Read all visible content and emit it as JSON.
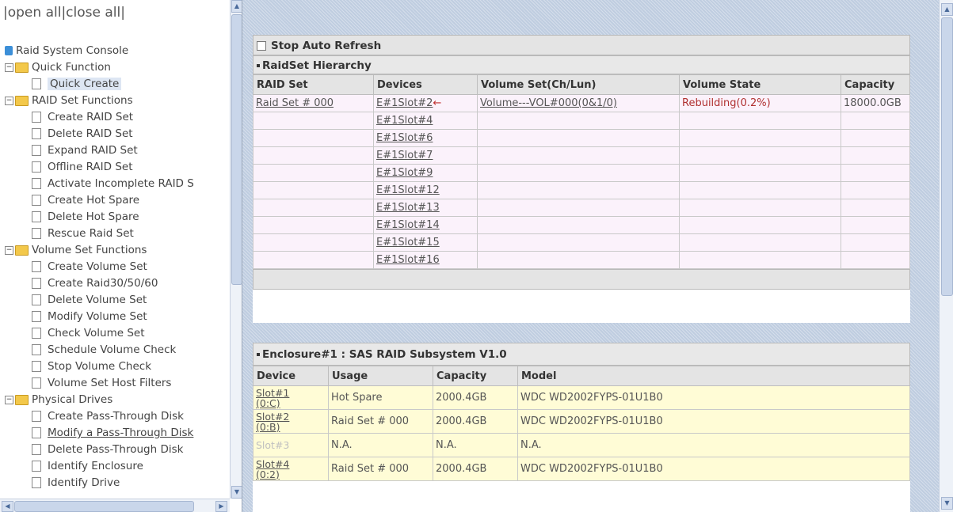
{
  "left": {
    "open_all": "open all",
    "close_all": "close all",
    "root": "Raid System Console",
    "groups": [
      {
        "label": "Quick Function",
        "items": [
          "Quick Create"
        ]
      },
      {
        "label": "RAID Set Functions",
        "items": [
          "Create RAID Set",
          "Delete RAID Set",
          "Expand RAID Set",
          "Offline RAID Set",
          "Activate Incomplete RAID S",
          "Create Hot Spare",
          "Delete Hot Spare",
          "Rescue Raid Set"
        ]
      },
      {
        "label": "Volume Set Functions",
        "items": [
          "Create Volume Set",
          "Create Raid30/50/60",
          "Delete Volume Set",
          "Modify Volume Set",
          "Check Volume Set",
          "Schedule Volume Check",
          "Stop Volume Check",
          "Volume Set Host Filters"
        ]
      },
      {
        "label": "Physical Drives",
        "items": [
          "Create Pass-Through Disk",
          "Modify a Pass-Through Disk",
          "Delete Pass-Through Disk",
          "Identify Enclosure",
          "Identify Drive"
        ]
      }
    ]
  },
  "refresh": {
    "label": "Stop Auto Refresh"
  },
  "raidset": {
    "title": "RaidSet Hierarchy",
    "headers": [
      "RAID Set",
      "Devices",
      "Volume Set(Ch/Lun)",
      "Volume State",
      "Capacity"
    ],
    "raid_set": "Raid Set # 000",
    "volume": "Volume---VOL#000(0&1/0)",
    "state": "Rebuilding(0.2%)",
    "capacity": "18000.0GB",
    "rebuild_arrow": "←",
    "devices": [
      "E#1Slot#2",
      "E#1Slot#4",
      "E#1Slot#6",
      "E#1Slot#7",
      "E#1Slot#9",
      "E#1Slot#12",
      "E#1Slot#13",
      "E#1Slot#14",
      "E#1Slot#15",
      "E#1Slot#16"
    ]
  },
  "enclosure": {
    "title": "Enclosure#1 : SAS RAID Subsystem V1.0",
    "headers": [
      "Device",
      "Usage",
      "Capacity",
      "Model"
    ],
    "rows": [
      {
        "device": "Slot#1",
        "ch": "(0:C)",
        "usage": "Hot Spare",
        "capacity": "2000.4GB",
        "model": "WDC WD2002FYPS-01U1B0",
        "na": false
      },
      {
        "device": "Slot#2",
        "ch": "(0:B)",
        "usage": "Raid Set # 000",
        "capacity": "2000.4GB",
        "model": "WDC WD2002FYPS-01U1B0",
        "na": false
      },
      {
        "device": "Slot#3",
        "ch": "",
        "usage": "N.A.",
        "capacity": "N.A.",
        "model": "N.A.",
        "na": true
      },
      {
        "device": "Slot#4",
        "ch": "(0:2)",
        "usage": "Raid Set # 000",
        "capacity": "2000.4GB",
        "model": "WDC WD2002FYPS-01U1B0",
        "na": false
      }
    ]
  }
}
